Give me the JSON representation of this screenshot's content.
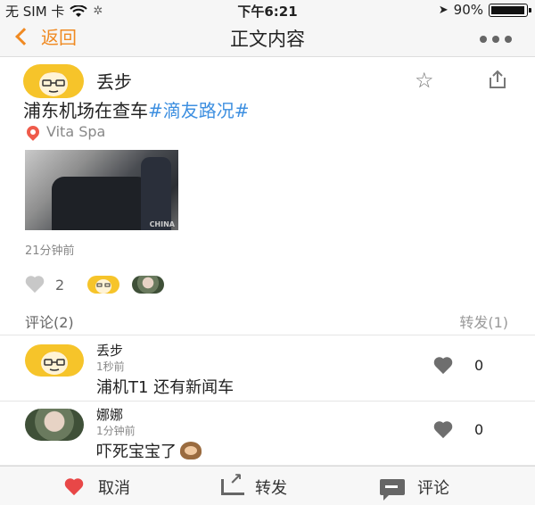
{
  "status_bar": {
    "carrier": "无 SIM 卡",
    "wifi_icon": "wifi-icon",
    "loading_icon": "spinner-icon",
    "time": "下午6:21",
    "location_icon": "location-arrow-icon",
    "battery": "90%",
    "battery_level": 0.9
  },
  "nav": {
    "back_label": "返回",
    "title": "正文内容",
    "accent_color": "#f08a22"
  },
  "post": {
    "author": "丢步",
    "content_prefix": "浦东机场在查车",
    "hashtag": "#滴友路况#",
    "location": "Vita Spa",
    "photo_watermark": "CHINA",
    "time": "21分钟前",
    "like_count": "2"
  },
  "tabs": {
    "comments_label": "评论(2)",
    "reposts_label": "转发(1)"
  },
  "comments": [
    {
      "name": "丢步",
      "time": "1秒前",
      "text": "浦机T1  还有新闻车",
      "likes": "0"
    },
    {
      "name": "娜娜",
      "time": "1分钟前",
      "text": "吓死宝宝了",
      "likes": "0"
    }
  ],
  "bottom_bar": {
    "unlike_label": "取消",
    "repost_label": "转发",
    "comment_label": "评论"
  }
}
